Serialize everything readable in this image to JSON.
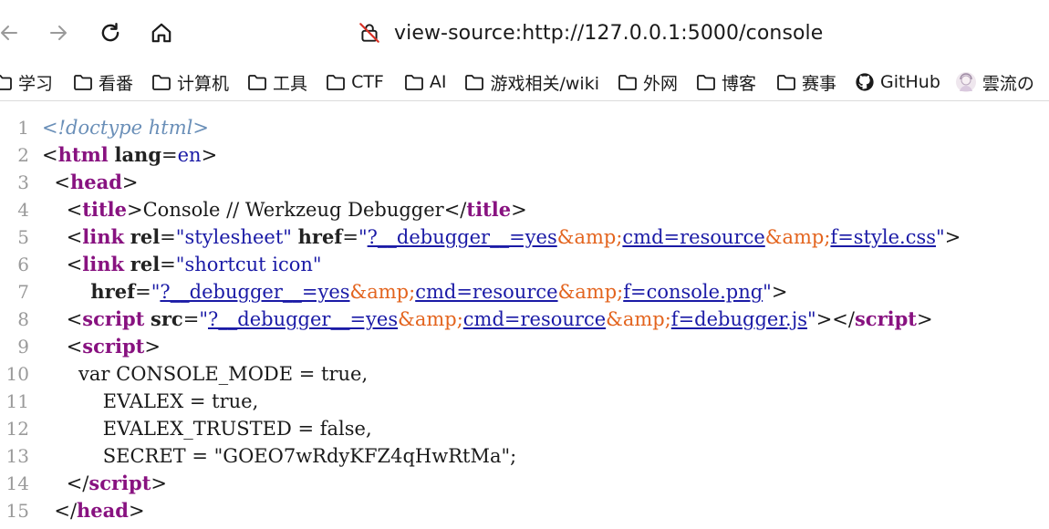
{
  "toolbar": {
    "url": "view-source:http://127.0.0.1:5000/console"
  },
  "bookmarks": [
    {
      "label": "学习",
      "icon": "folder-icon"
    },
    {
      "label": "看番",
      "icon": "folder-icon"
    },
    {
      "label": "计算机",
      "icon": "folder-icon"
    },
    {
      "label": "工具",
      "icon": "folder-icon"
    },
    {
      "label": "CTF",
      "icon": "folder-icon"
    },
    {
      "label": "AI",
      "icon": "folder-icon"
    },
    {
      "label": "游戏相关/wiki",
      "icon": "folder-icon"
    },
    {
      "label": "外网",
      "icon": "folder-icon"
    },
    {
      "label": "博客",
      "icon": "folder-icon"
    },
    {
      "label": "赛事",
      "icon": "folder-icon"
    },
    {
      "label": "GitHub",
      "icon": "github-icon"
    },
    {
      "label": "雲流の",
      "icon": "avatar-icon"
    }
  ],
  "source": {
    "line_numbers": [
      "1",
      "2",
      "3",
      "4",
      "5",
      "6",
      "7",
      "8",
      "9",
      "10",
      "11",
      "12",
      "13",
      "14",
      "15"
    ],
    "lines": [
      [
        {
          "t": "doctype",
          "v": "<!doctype html>"
        }
      ],
      [
        {
          "t": "plain",
          "v": "<"
        },
        {
          "t": "tag",
          "v": "html"
        },
        {
          "t": "plain",
          "v": " "
        },
        {
          "t": "attr",
          "v": "lang"
        },
        {
          "t": "plain",
          "v": "="
        },
        {
          "t": "val",
          "v": "en"
        },
        {
          "t": "plain",
          "v": ">"
        }
      ],
      [
        {
          "t": "plain",
          "v": "  <"
        },
        {
          "t": "tag",
          "v": "head"
        },
        {
          "t": "plain",
          "v": ">"
        }
      ],
      [
        {
          "t": "plain",
          "v": "    <"
        },
        {
          "t": "tag",
          "v": "title"
        },
        {
          "t": "plain",
          "v": ">Console // Werkzeug Debugger</"
        },
        {
          "t": "tag",
          "v": "title"
        },
        {
          "t": "plain",
          "v": ">"
        }
      ],
      [
        {
          "t": "plain",
          "v": "    <"
        },
        {
          "t": "tag",
          "v": "link"
        },
        {
          "t": "plain",
          "v": " "
        },
        {
          "t": "attr",
          "v": "rel"
        },
        {
          "t": "plain",
          "v": "="
        },
        {
          "t": "val",
          "v": "\"stylesheet\""
        },
        {
          "t": "plain",
          "v": " "
        },
        {
          "t": "attr",
          "v": "href"
        },
        {
          "t": "plain",
          "v": "="
        },
        {
          "t": "val",
          "v": "\""
        },
        {
          "t": "link",
          "v": "?__debugger__=yes"
        },
        {
          "t": "ent",
          "v": "&amp;"
        },
        {
          "t": "link",
          "v": "cmd=resource"
        },
        {
          "t": "ent",
          "v": "&amp;"
        },
        {
          "t": "link",
          "v": "f=style.css"
        },
        {
          "t": "val",
          "v": "\""
        },
        {
          "t": "plain",
          "v": ">"
        }
      ],
      [
        {
          "t": "plain",
          "v": "    <"
        },
        {
          "t": "tag",
          "v": "link"
        },
        {
          "t": "plain",
          "v": " "
        },
        {
          "t": "attr",
          "v": "rel"
        },
        {
          "t": "plain",
          "v": "="
        },
        {
          "t": "val",
          "v": "\"shortcut icon\""
        }
      ],
      [
        {
          "t": "plain",
          "v": "        "
        },
        {
          "t": "attr",
          "v": "href"
        },
        {
          "t": "plain",
          "v": "="
        },
        {
          "t": "val",
          "v": "\""
        },
        {
          "t": "link",
          "v": "?__debugger__=yes"
        },
        {
          "t": "ent",
          "v": "&amp;"
        },
        {
          "t": "link",
          "v": "cmd=resource"
        },
        {
          "t": "ent",
          "v": "&amp;"
        },
        {
          "t": "link",
          "v": "f=console.png"
        },
        {
          "t": "val",
          "v": "\""
        },
        {
          "t": "plain",
          "v": ">"
        }
      ],
      [
        {
          "t": "plain",
          "v": "    <"
        },
        {
          "t": "tag",
          "v": "script"
        },
        {
          "t": "plain",
          "v": " "
        },
        {
          "t": "attr",
          "v": "src"
        },
        {
          "t": "plain",
          "v": "="
        },
        {
          "t": "val",
          "v": "\""
        },
        {
          "t": "link",
          "v": "?__debugger__=yes"
        },
        {
          "t": "ent",
          "v": "&amp;"
        },
        {
          "t": "link",
          "v": "cmd=resource"
        },
        {
          "t": "ent",
          "v": "&amp;"
        },
        {
          "t": "link",
          "v": "f=debugger.js"
        },
        {
          "t": "val",
          "v": "\""
        },
        {
          "t": "plain",
          "v": "></"
        },
        {
          "t": "tag",
          "v": "script"
        },
        {
          "t": "plain",
          "v": ">"
        }
      ],
      [
        {
          "t": "plain",
          "v": "    <"
        },
        {
          "t": "tag",
          "v": "script"
        },
        {
          "t": "plain",
          "v": ">"
        }
      ],
      [
        {
          "t": "plain",
          "v": "      var CONSOLE_MODE = true,"
        }
      ],
      [
        {
          "t": "plain",
          "v": "          EVALEX = true,"
        }
      ],
      [
        {
          "t": "plain",
          "v": "          EVALEX_TRUSTED = false,"
        }
      ],
      [
        {
          "t": "plain",
          "v": "          SECRET = \"GOEO7wRdyKFZ4qHwRtMa\";"
        }
      ],
      [
        {
          "t": "plain",
          "v": "    </"
        },
        {
          "t": "tag",
          "v": "script"
        },
        {
          "t": "plain",
          "v": ">"
        }
      ],
      [
        {
          "t": "plain",
          "v": "  </"
        },
        {
          "t": "tag",
          "v": "head"
        },
        {
          "t": "plain",
          "v": ">"
        }
      ]
    ]
  }
}
